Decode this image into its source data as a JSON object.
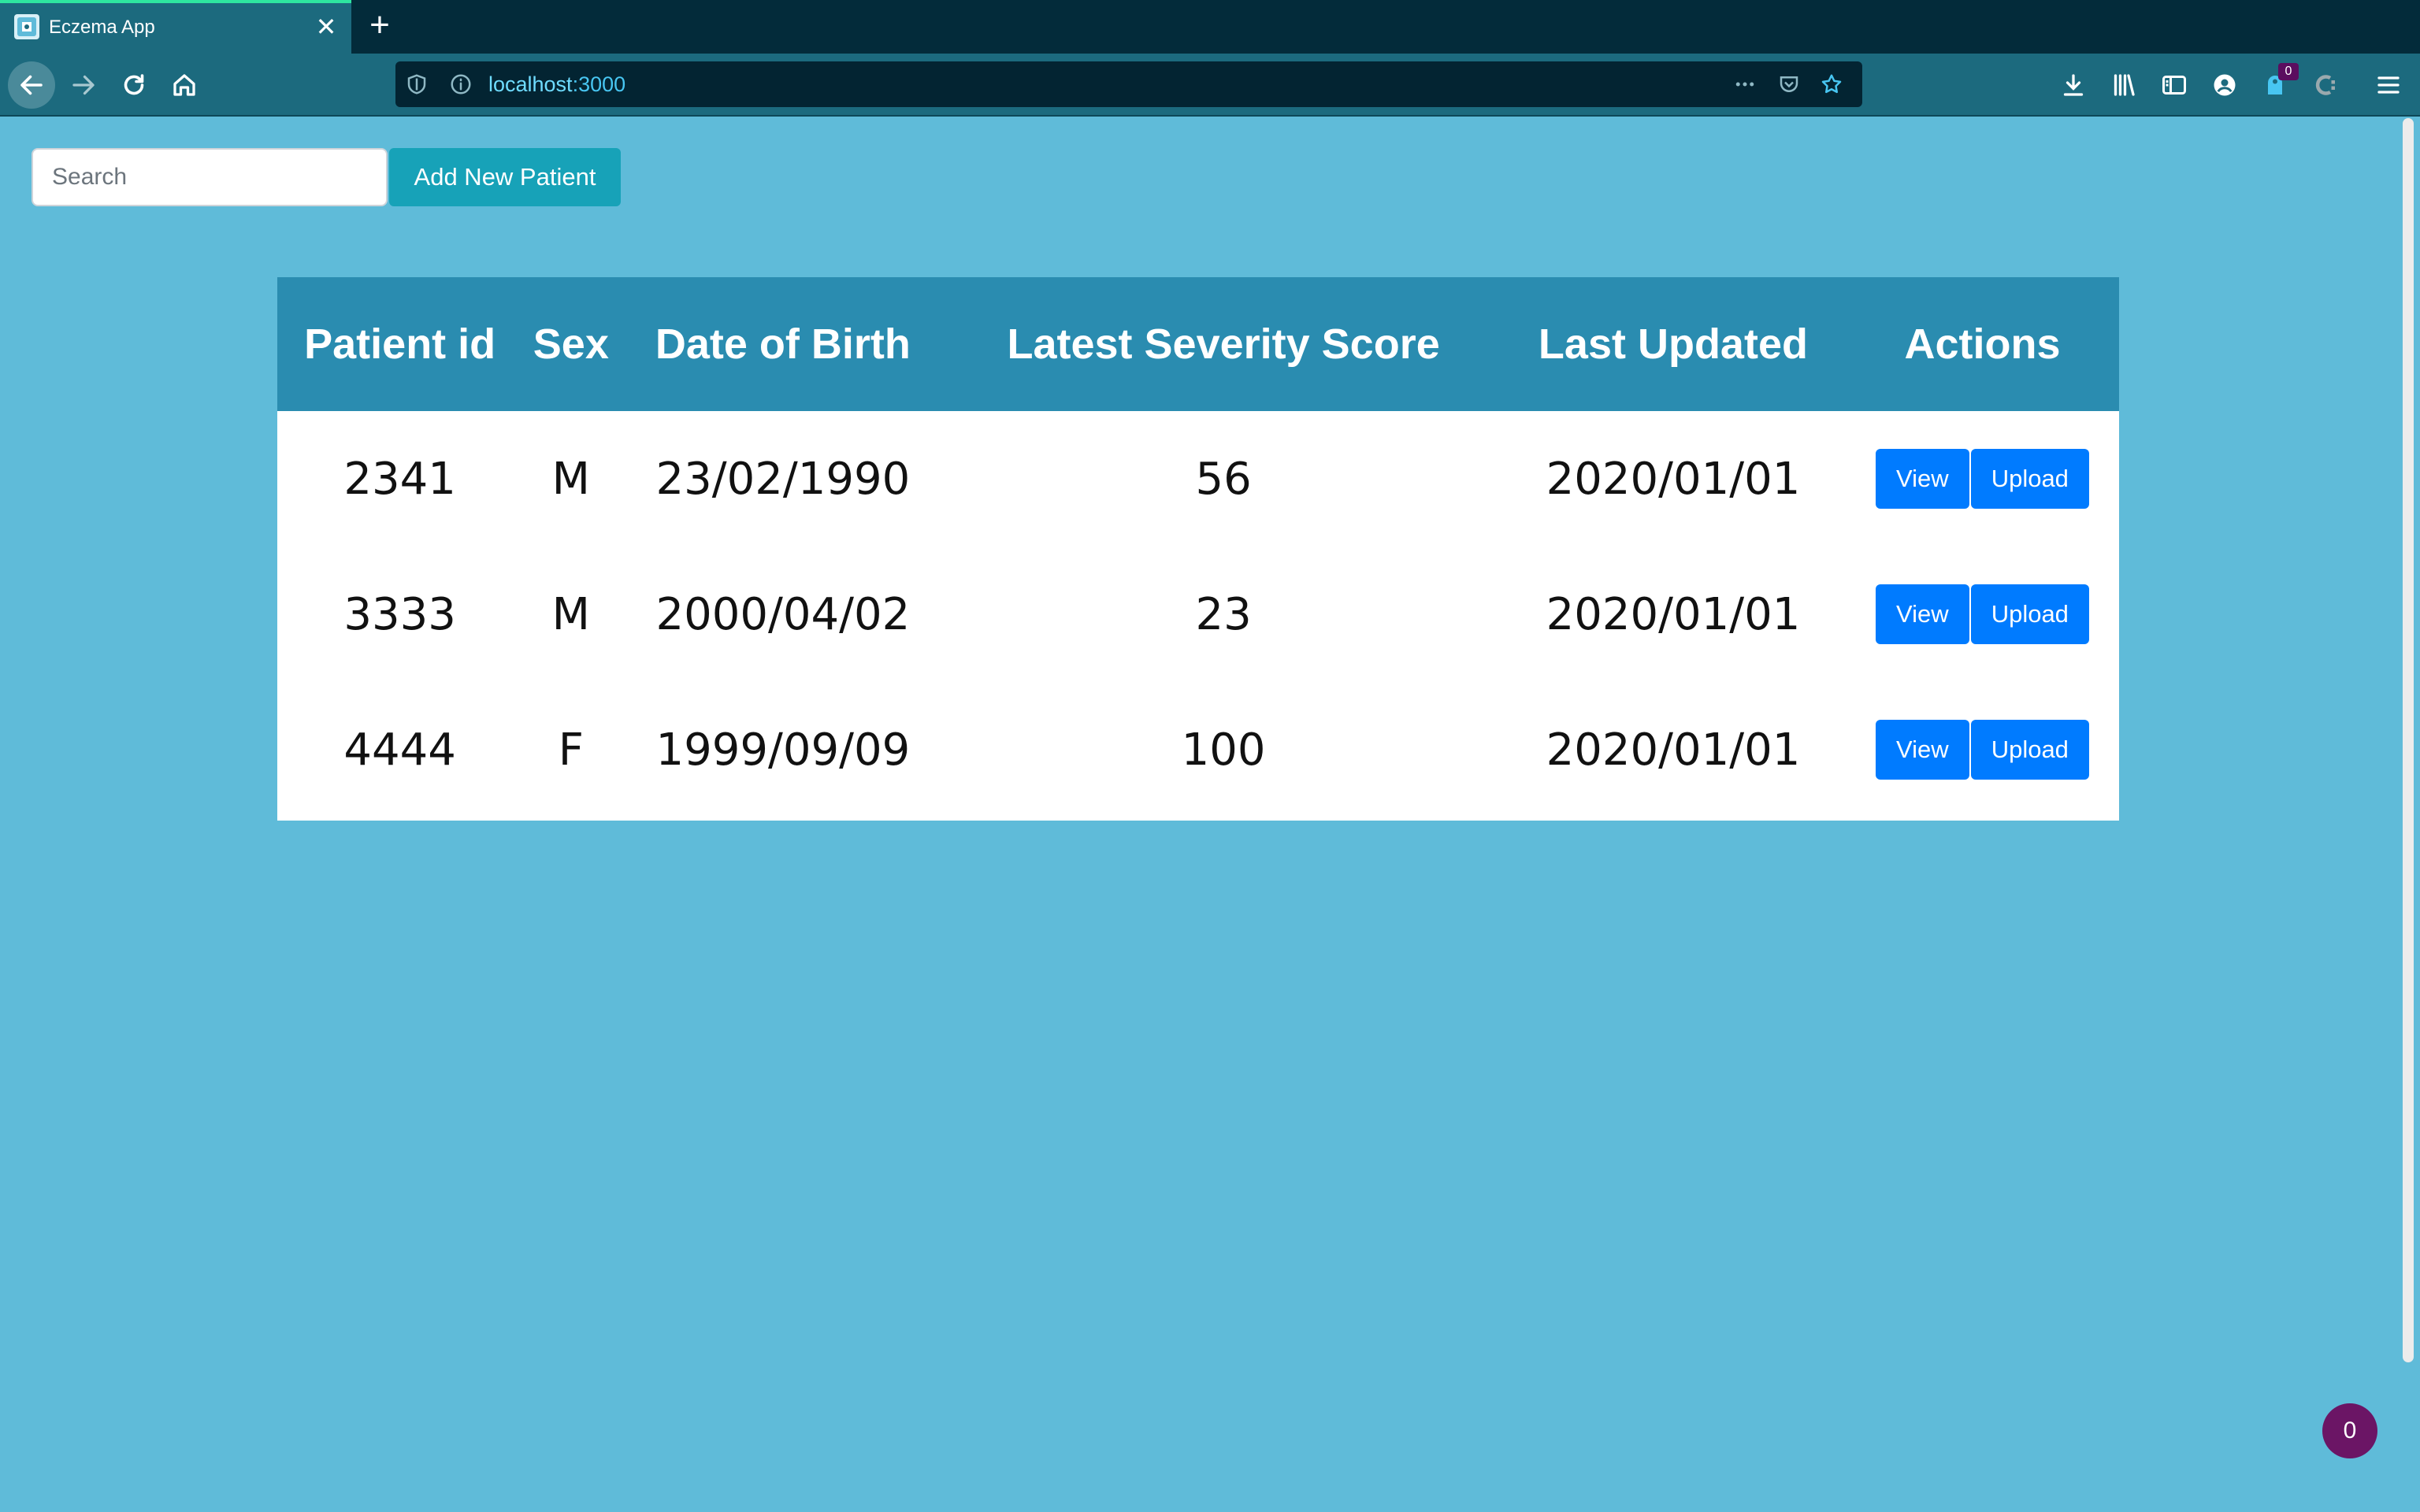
{
  "browser": {
    "tab_title": "Eczema App",
    "url_host": "localhost",
    "url_port": ":3000",
    "notification_count": "0"
  },
  "toolbar": {
    "search_placeholder": "Search",
    "add_button_label": "Add New Patient"
  },
  "table": {
    "headers": [
      "Patient id",
      "Sex",
      "Date of Birth",
      "Latest Severity Score",
      "Last Updated",
      "Actions"
    ],
    "rows": [
      {
        "id": "2341",
        "sex": "M",
        "dob": "23/02/1990",
        "score": "56",
        "updated": "2020/01/01",
        "view": "View",
        "upload": "Upload"
      },
      {
        "id": "3333",
        "sex": "M",
        "dob": "2000/04/02",
        "score": "23",
        "updated": "2020/01/01",
        "view": "View",
        "upload": "Upload"
      },
      {
        "id": "4444",
        "sex": "F",
        "dob": "1999/09/09",
        "score": "100",
        "updated": "2020/01/01",
        "view": "View",
        "upload": "Upload"
      }
    ]
  },
  "chat_badge": "0",
  "colors": {
    "page_bg": "#5fbbd9",
    "header_bg": "#2a8cb0",
    "add_button": "#17a2b8",
    "action_button": "#007bff"
  }
}
